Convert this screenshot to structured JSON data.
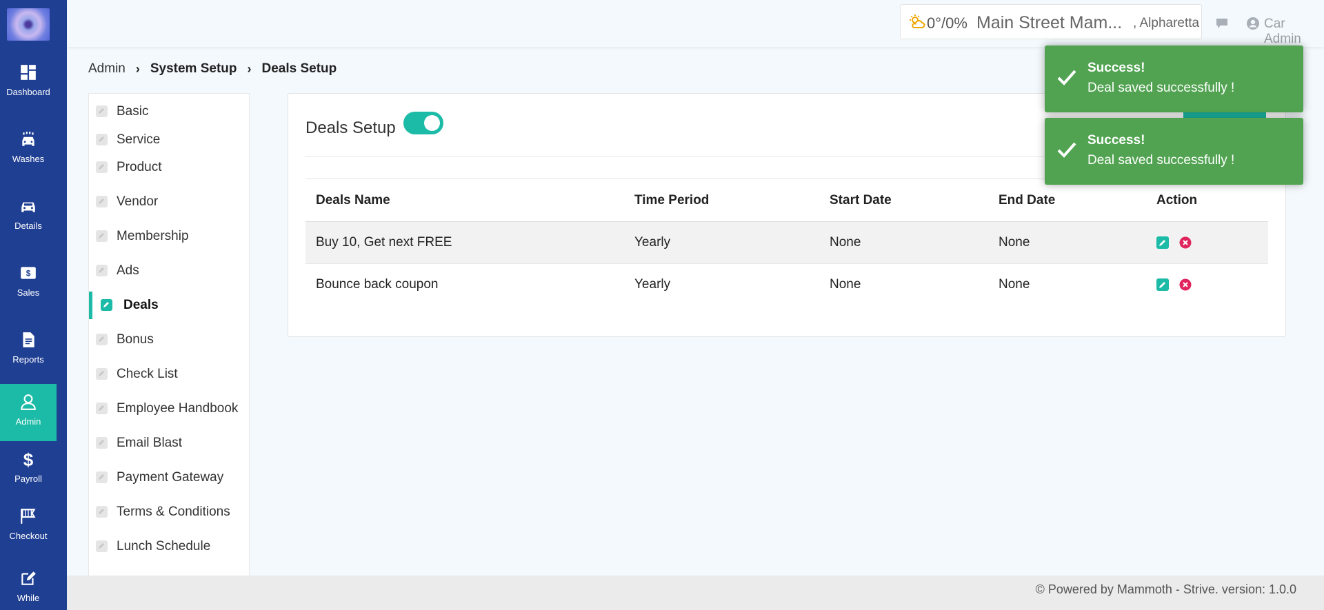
{
  "nav": {
    "items": [
      {
        "label": "Dashboard",
        "icon": "dashboard-icon"
      },
      {
        "label": "Washes",
        "icon": "car-wash-icon"
      },
      {
        "label": "Details",
        "icon": "car-icon"
      },
      {
        "label": "Sales",
        "icon": "money-icon"
      },
      {
        "label": "Reports",
        "icon": "report-icon"
      },
      {
        "label": "Admin",
        "icon": "user-icon",
        "active": true
      },
      {
        "label": "Payroll",
        "icon": "dollar-icon"
      },
      {
        "label": "Checkout",
        "icon": "flag-icon"
      },
      {
        "label": "While",
        "icon": "edit-icon"
      }
    ]
  },
  "topbar": {
    "temperature": "0°/0%",
    "location_main": "Main Street Mam...",
    "location_city": ", Alpharetta",
    "user_name": "Car Admin"
  },
  "breadcrumb": [
    "Admin",
    "System Setup",
    "Deals Setup"
  ],
  "sidemenu": {
    "items": [
      "Basic",
      "Service",
      "Product",
      "Vendor",
      "Membership",
      "Ads",
      "Deals",
      "Bonus",
      "Check List",
      "Employee Handbook",
      "Email Blast",
      "Payment Gateway",
      "Terms & Conditions",
      "Lunch Schedule"
    ],
    "active": "Deals"
  },
  "card": {
    "title": "Deals Setup",
    "toggle_on": true
  },
  "table": {
    "headers": [
      "Deals Name",
      "Time Period",
      "Start Date",
      "End Date",
      "Action"
    ],
    "rows": [
      [
        "Buy 10, Get next FREE",
        "Yearly",
        "None",
        "None"
      ],
      [
        "Bounce back coupon",
        "Yearly",
        "None",
        "None"
      ]
    ]
  },
  "toasts": [
    {
      "title": "Success!",
      "message": "Deal saved successfully !"
    },
    {
      "title": "Success!",
      "message": "Deal saved successfully !"
    }
  ],
  "footer": {
    "text": "© Powered by Mammoth - Strive. version: 1.0.0"
  },
  "colors": {
    "nav_bg": "#1f3f93",
    "accent": "#1cbba7",
    "toast_bg": "#51a351",
    "delete": "#e0245e"
  }
}
